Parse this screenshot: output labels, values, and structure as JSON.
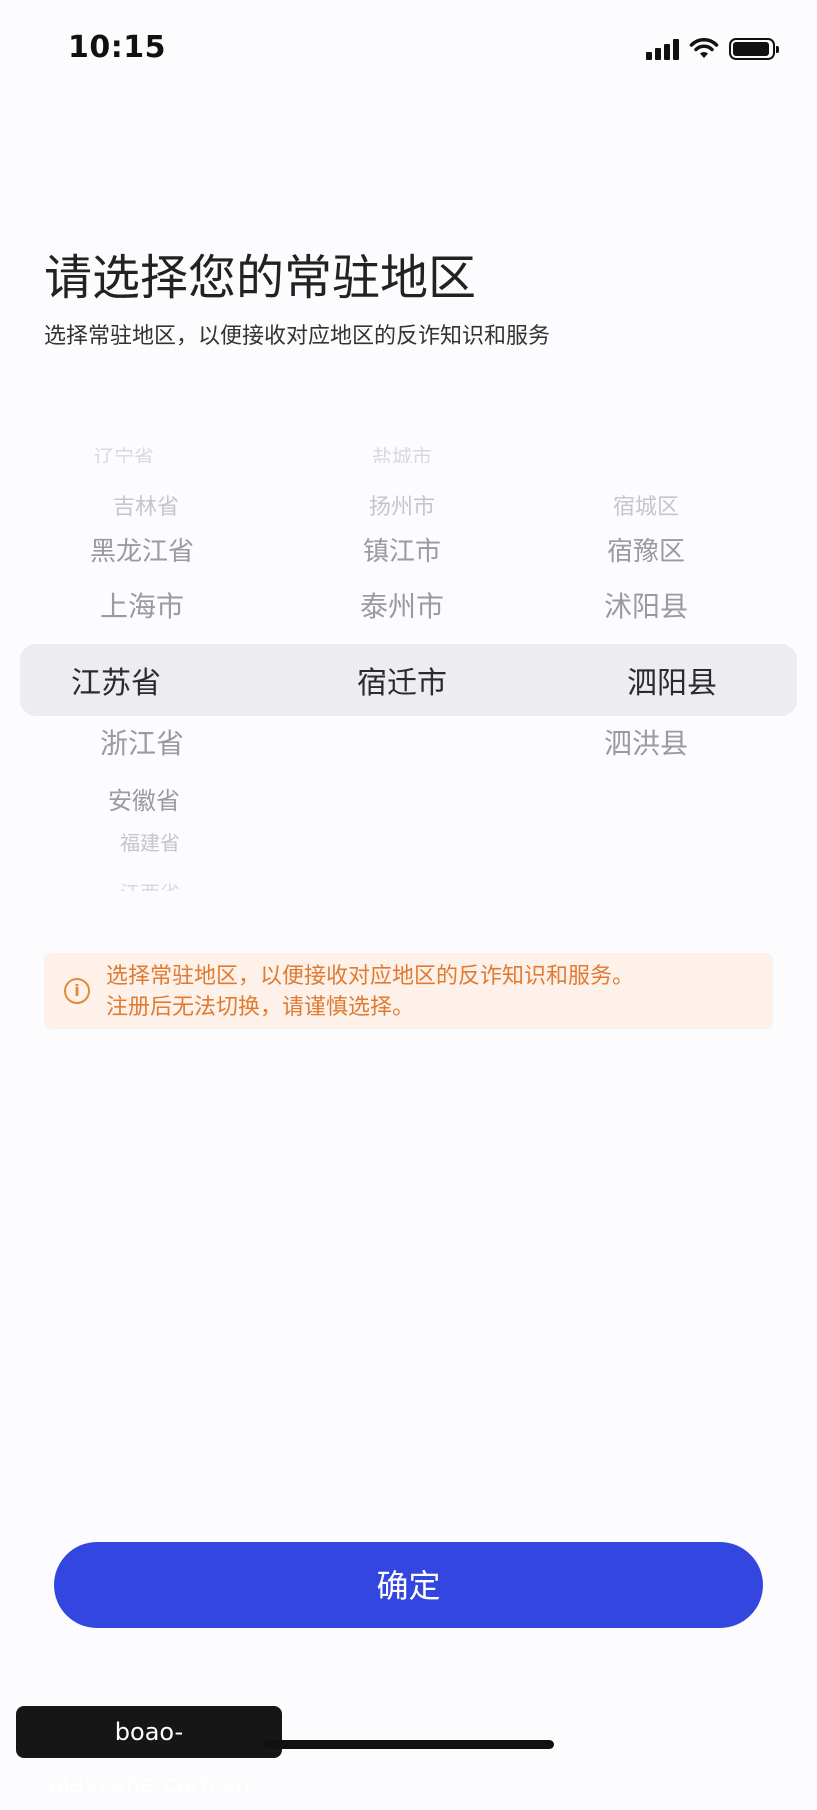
{
  "status_bar": {
    "time": "10:15",
    "icons": [
      "signal-icon",
      "wifi-icon",
      "battery-icon"
    ]
  },
  "header": {
    "title": "请选择您的常驻地区",
    "subtitle": "选择常驻地区，以便接收对应地区的反诈知识和服务"
  },
  "picker": {
    "provinces": {
      "cut_top": "辽宁省",
      "items": [
        "吉林省",
        "黑龙江省",
        "上海市",
        "江苏省",
        "浙江省",
        "安徽省",
        "福建省"
      ],
      "selected": "江苏省",
      "cut_bottom": "江西省"
    },
    "cities": {
      "cut_top": "盐城市",
      "items": [
        "扬州市",
        "镇江市",
        "泰州市",
        "宿迁市"
      ],
      "selected": "宿迁市"
    },
    "districts": {
      "items": [
        "宿城区",
        "宿豫区",
        "沭阳县",
        "泗阳县",
        "泗洪县"
      ],
      "selected": "泗阳县"
    }
  },
  "notice": {
    "icon": "info-icon",
    "line1": "选择常驻地区，以便接收对应地区的反诈知识和服务。",
    "line2": "注册后无法切换，请谨慎选择。",
    "color": "#e07b31"
  },
  "confirm_button": {
    "label": "确定",
    "color": "#3446e0"
  },
  "watermark": "boao-playzone.com.cn"
}
